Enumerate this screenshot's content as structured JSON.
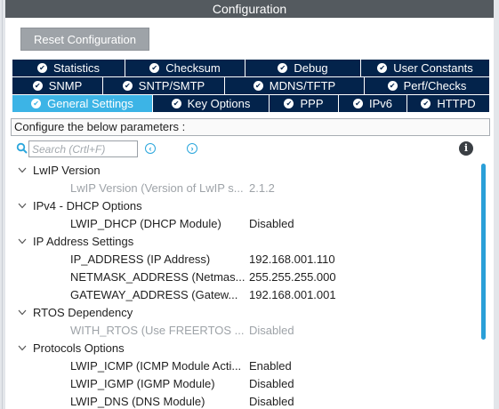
{
  "window": {
    "title": "Configuration"
  },
  "toolbar": {
    "reset_label": "Reset Configuration"
  },
  "tabs": {
    "row1": [
      {
        "label": "Statistics"
      },
      {
        "label": "Checksum"
      },
      {
        "label": "Debug"
      },
      {
        "label": "User Constants"
      }
    ],
    "row2": [
      {
        "label": "SNMP"
      },
      {
        "label": "SNTP/SMTP"
      },
      {
        "label": "MDNS/TFTP"
      },
      {
        "label": "Perf/Checks"
      }
    ],
    "row3": [
      {
        "label": "General Settings",
        "active": true
      },
      {
        "label": "Key Options"
      },
      {
        "label": "PPP"
      },
      {
        "label": "IPv6"
      },
      {
        "label": "HTTPD"
      }
    ]
  },
  "params_header": "Configure the below parameters :",
  "search": {
    "placeholder": "Search (Crtl+F)"
  },
  "tree": [
    {
      "group": "LwIP Version",
      "params": [
        {
          "name": "LwIP Version (Version of LwIP s...",
          "value": "2.1.2",
          "disabled": true
        }
      ]
    },
    {
      "group": "IPv4 - DHCP Options",
      "params": [
        {
          "name": "LWIP_DHCP (DHCP Module)",
          "value": "Disabled",
          "disabled": false
        }
      ]
    },
    {
      "group": "IP Address Settings",
      "params": [
        {
          "name": "IP_ADDRESS (IP Address)",
          "value": "192.168.001.110",
          "disabled": false
        },
        {
          "name": "NETMASK_ADDRESS (Netmas...",
          "value": "255.255.255.000",
          "disabled": false
        },
        {
          "name": "GATEWAY_ADDRESS (Gatew...",
          "value": "192.168.001.001",
          "disabled": false
        }
      ]
    },
    {
      "group": "RTOS Dependency",
      "params": [
        {
          "name": "WITH_RTOS (Use FREERTOS ...",
          "value": "Disabled",
          "disabled": true
        }
      ]
    },
    {
      "group": "Protocols Options",
      "params": [
        {
          "name": "LWIP_ICMP (ICMP Module Acti...",
          "value": "Enabled",
          "disabled": false
        },
        {
          "name": "LWIP_IGMP (IGMP Module)",
          "value": "Disabled",
          "disabled": false
        },
        {
          "name": "LWIP_DNS (DNS Module)",
          "value": "Disabled",
          "disabled": false
        }
      ]
    }
  ],
  "colors": {
    "tab_bg": "#03234b",
    "tab_active": "#3cb4e6",
    "title_bar": "#545a5f",
    "accent": "#2aa6dc"
  }
}
